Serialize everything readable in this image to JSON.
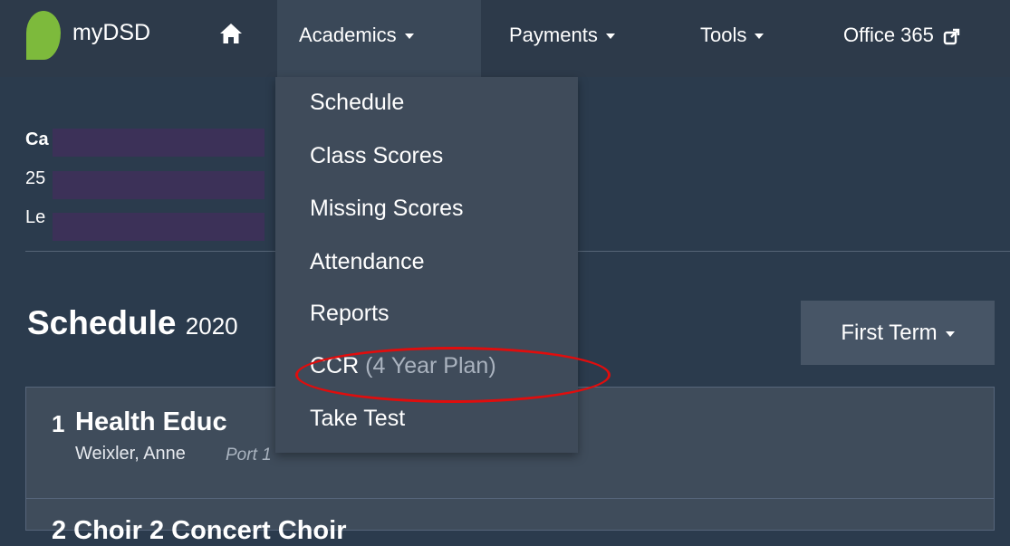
{
  "navbar": {
    "brand": "myDSD",
    "items": [
      {
        "label": "Academics"
      },
      {
        "label": "Payments"
      },
      {
        "label": "Tools"
      },
      {
        "label": "Office 365"
      }
    ]
  },
  "student": {
    "name_partial": "Ca",
    "email_partial": "25",
    "school_partial": "Le"
  },
  "schedule": {
    "title": "Schedule",
    "year_partial": "2020",
    "term_label": "First Term"
  },
  "classes": [
    {
      "period": "1",
      "name_partial": "Health Educ",
      "teacher": "Weixler, Anne",
      "room": "Port 1"
    },
    {
      "period": "2",
      "name_partial": "2 Choir 2 Concert Choir"
    }
  ],
  "academics_menu": {
    "items": [
      {
        "label": "Schedule"
      },
      {
        "label": "Class Scores"
      },
      {
        "label": "Missing Scores"
      },
      {
        "label": "Attendance"
      },
      {
        "label": "Reports"
      },
      {
        "label": "CCR",
        "suffix": " (4 Year Plan)"
      },
      {
        "label": "Take Test"
      }
    ]
  },
  "colors": {
    "navbar_bg": "#2d3a4a",
    "page_bg": "#2b3b4d",
    "dropdown_bg": "#3f4b5a",
    "logo_green": "#7dba3c",
    "highlight_red": "#e00d0d",
    "redaction": "#3c3158"
  },
  "icons": {
    "home": "home-icon",
    "caret": "caret-down-icon",
    "external": "external-link-icon"
  }
}
